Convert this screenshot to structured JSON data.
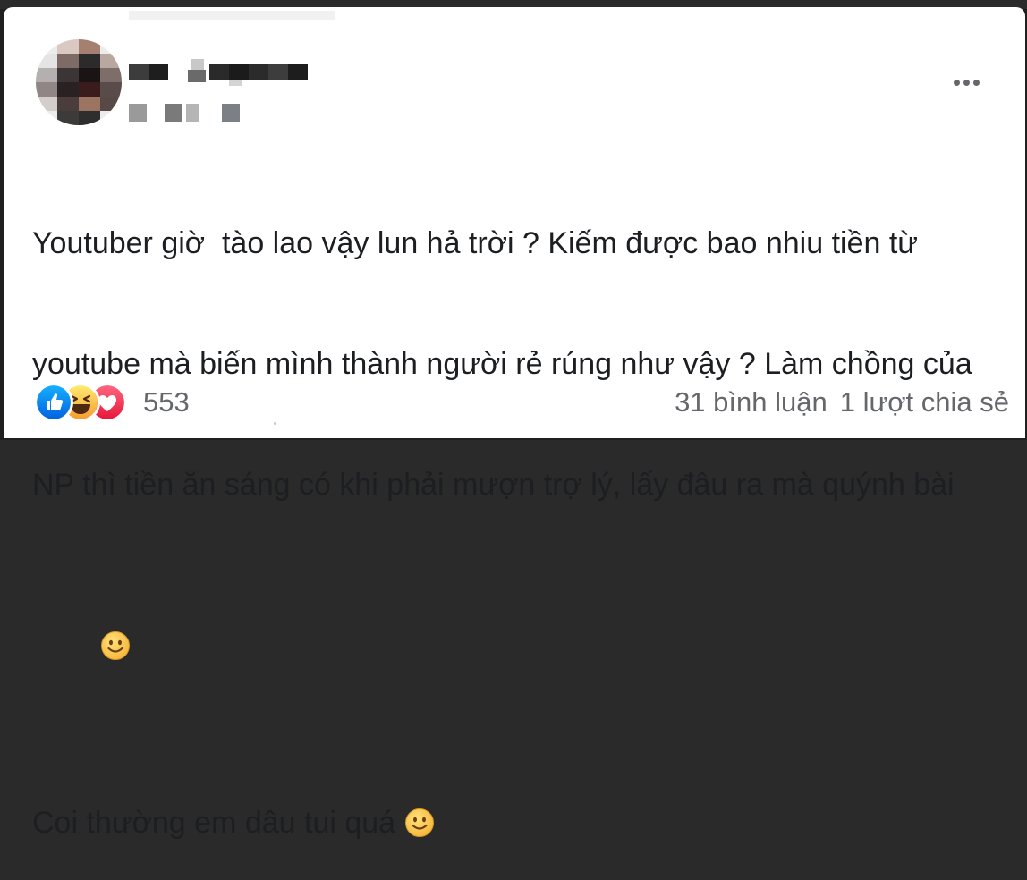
{
  "post": {
    "author_name": "",
    "meta": "",
    "more_icon": "more-horizontal-icon",
    "body_line_1": "Youtuber giờ  tào lao vậy lun hả trời ? Kiếm được bao nhiu tiền từ",
    "body_line_2": "youtube mà biến mình thành người rẻ rúng như vậy ? Làm chồng của",
    "body_line_3": "NP thì tiền ăn sáng có khi phải mượn trợ lý, lấy đâu ra mà quýnh bài",
    "body_line_5": "Coi thường em dâu tui quá ",
    "emoji_icon": "smiling-face-emoji"
  },
  "reactions": {
    "types": [
      "like-reaction-icon",
      "haha-reaction-icon",
      "love-reaction-icon"
    ],
    "count": "553"
  },
  "stats": {
    "comments": "31 bình luận",
    "shares": "1 lượt chia sẻ"
  },
  "colors": {
    "like": "#1877f2",
    "love": "#f33e58",
    "haha": "#f7b125",
    "secondary_text": "#65676b"
  }
}
